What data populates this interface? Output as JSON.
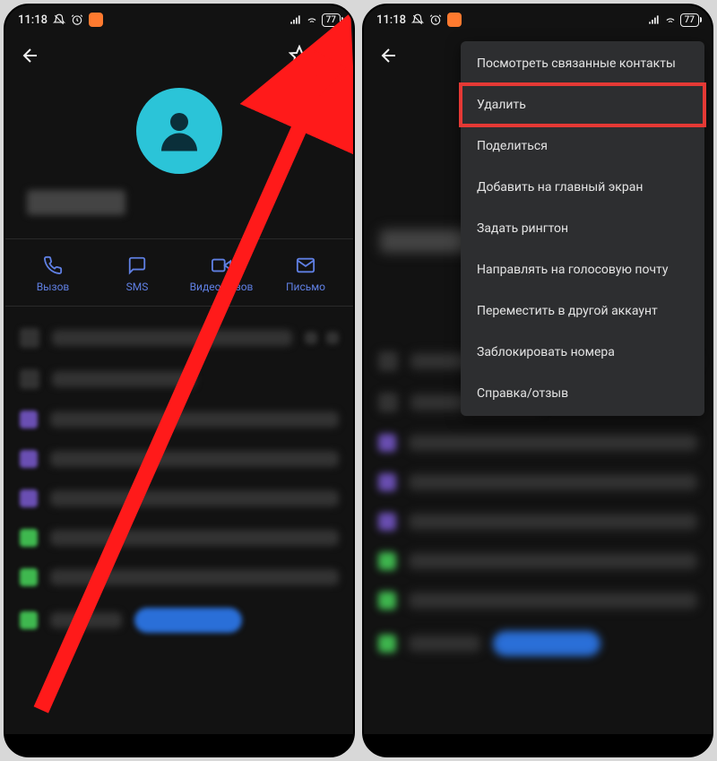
{
  "status": {
    "time": "11:18",
    "battery": "77"
  },
  "actions": {
    "call": "Вызов",
    "sms": "SMS",
    "video": "Видеовызов",
    "email": "Письмо"
  },
  "menu": {
    "items": [
      "Посмотреть связанные контакты",
      "Удалить",
      "Поделиться",
      "Добавить на главный экран",
      "Задать рингтон",
      "Направлять на голосовую почту",
      "Переместить в другой аккаунт",
      "Заблокировать номера",
      "Справка/отзыв"
    ],
    "highlight_index": 1
  },
  "colors": {
    "avatar_bg": "#2bc4d8",
    "action_tint": "#5f7fe2",
    "arrow": "#ff1a1a",
    "highlight": "#e53935"
  }
}
